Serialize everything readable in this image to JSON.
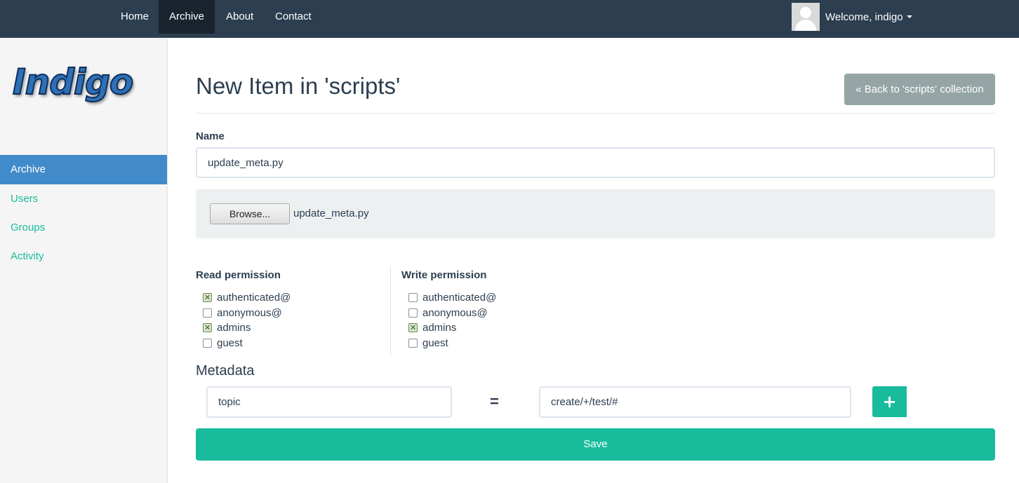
{
  "navbar": {
    "items": [
      {
        "label": "Home",
        "active": false
      },
      {
        "label": "Archive",
        "active": true
      },
      {
        "label": "About",
        "active": false
      },
      {
        "label": "Contact",
        "active": false
      }
    ],
    "user": {
      "welcome": "Welcome, indigo",
      "avatar_icon": "user-avatar-icon",
      "menu_icon": "caret-down-icon"
    }
  },
  "sidebar": {
    "logo_text": "Indigo",
    "items": [
      {
        "label": "Archive",
        "active": true
      },
      {
        "label": "Users",
        "active": false
      },
      {
        "label": "Groups",
        "active": false
      },
      {
        "label": "Activity",
        "active": false
      }
    ]
  },
  "main": {
    "title": "New Item in 'scripts'",
    "back_button": "« Back to 'scripts' collection",
    "name_label": "Name",
    "name_value": "update_meta.py",
    "browse_button": "Browse...",
    "selected_file": "update_meta.py",
    "read_permission": {
      "label": "Read permission",
      "options": [
        {
          "label": "authenticated@",
          "checked": true
        },
        {
          "label": "anonymous@",
          "checked": false
        },
        {
          "label": "admins",
          "checked": true
        },
        {
          "label": "guest",
          "checked": false
        }
      ]
    },
    "write_permission": {
      "label": "Write permission",
      "options": [
        {
          "label": "authenticated@",
          "checked": false
        },
        {
          "label": "anonymous@",
          "checked": false
        },
        {
          "label": "admins",
          "checked": true
        },
        {
          "label": "guest",
          "checked": false
        }
      ]
    },
    "metadata": {
      "title": "Metadata",
      "key": "topic",
      "separator": "=",
      "value": "create/+/test/#",
      "add_icon": "plus-icon"
    },
    "save_button": "Save"
  },
  "colors": {
    "navbar_bg": "#2c3e50",
    "accent": "#18bc9c",
    "sidebar_active": "#428bca",
    "secondary_button": "#95a5a6"
  }
}
